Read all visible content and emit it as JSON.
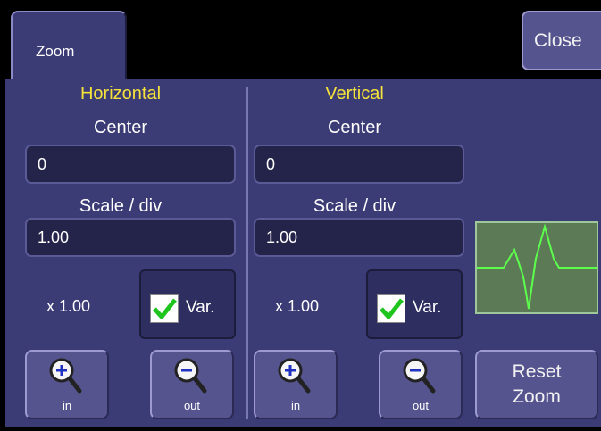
{
  "tab": {
    "label": "Zoom"
  },
  "close_label": "Close",
  "horizontal": {
    "title": "Horizontal",
    "center_label": "Center",
    "center_value": "0",
    "scale_label": "Scale / div",
    "scale_value": "1.00",
    "multiplier": "x 1.00",
    "var_label": "Var.",
    "var_checked": true,
    "zoom_in_label": "in",
    "zoom_out_label": "out"
  },
  "vertical": {
    "title": "Vertical",
    "center_label": "Center",
    "center_value": "0",
    "scale_label": "Scale / div",
    "scale_value": "1.00",
    "multiplier": "x 1.00",
    "var_label": "Var.",
    "var_checked": true,
    "zoom_in_label": "in",
    "zoom_out_label": "out"
  },
  "reset": {
    "line1": "Reset",
    "line2": "Zoom"
  },
  "colors": {
    "panel": "#3b3b76",
    "title_yellow": "#f4e23a",
    "check_green": "#1fc41f",
    "waveform_bg": "#5b7a55",
    "waveform_line": "#5dff4d"
  },
  "icons": [
    "magnifier-plus-icon",
    "magnifier-minus-icon",
    "checkmark-icon",
    "waveform-icon"
  ]
}
